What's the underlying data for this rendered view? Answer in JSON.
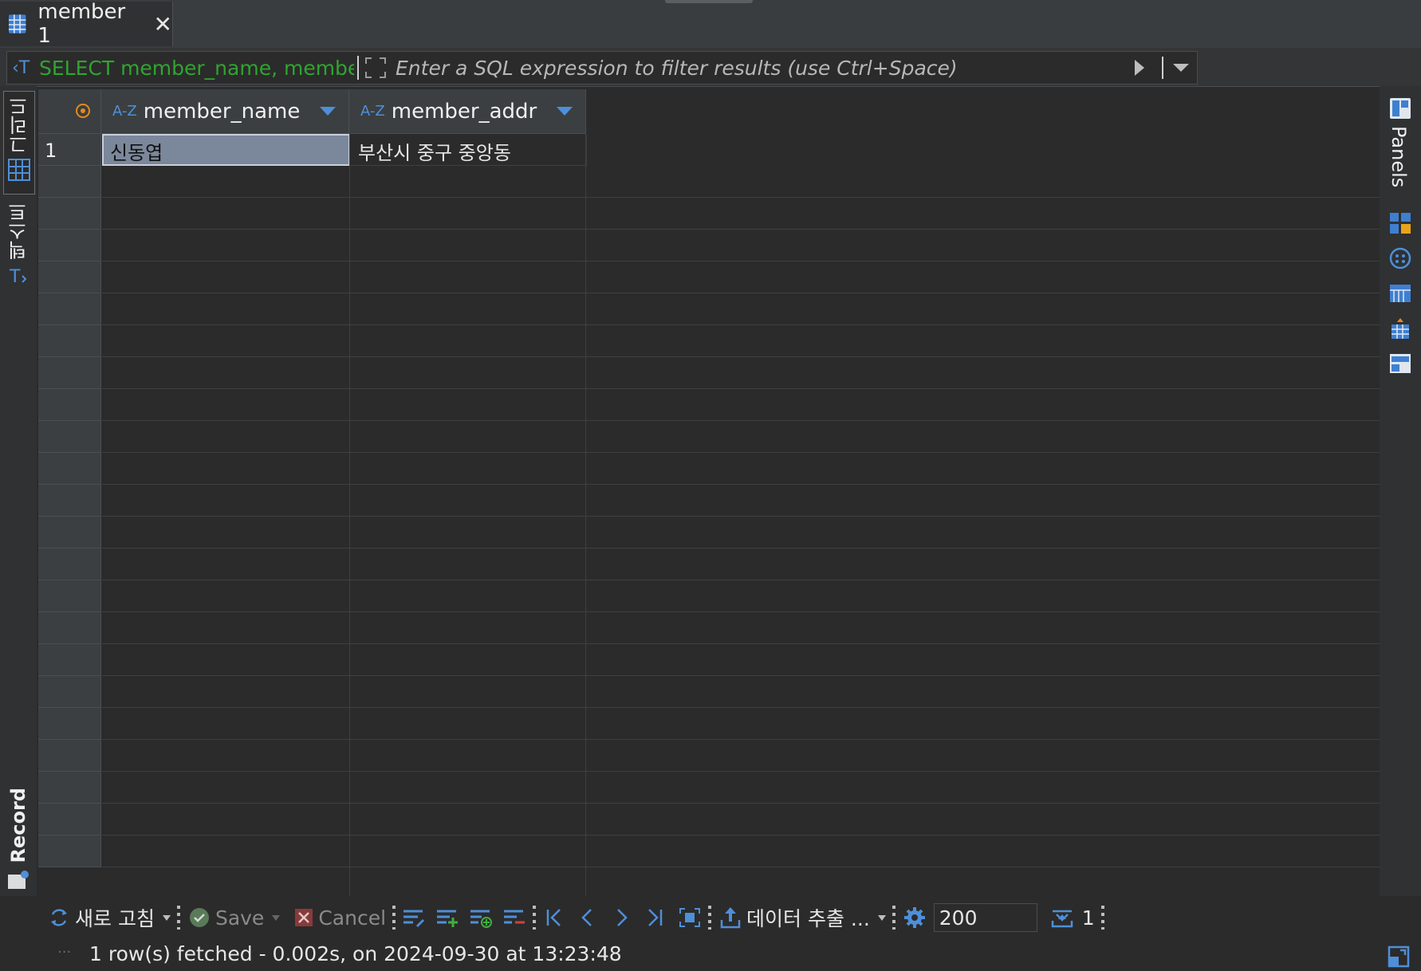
{
  "tab": {
    "title": "member 1",
    "close": "✕"
  },
  "filter": {
    "sql_prefix_icon": "sql-icon",
    "query": "SELECT member_name, membe",
    "placeholder": "Enter a SQL expression to filter results (use Ctrl+Space)"
  },
  "left_tabs": {
    "grid": "그리드",
    "text": "텍스트",
    "record": "Record"
  },
  "right_panel": {
    "label": "Panels"
  },
  "grid": {
    "columns": [
      {
        "type": "A-Z",
        "name": "member_name"
      },
      {
        "type": "A-Z",
        "name": "member_addr"
      }
    ],
    "rows": [
      {
        "num": "1",
        "cells": [
          "신동엽",
          "부산시 중구 중앙동"
        ]
      }
    ]
  },
  "toolbar": {
    "refresh": "새로 고침",
    "save": "Save",
    "cancel": "Cancel",
    "export": "데이터 추출 ...",
    "fetch_size": "200",
    "row_count": "1"
  },
  "status": {
    "message": "1 row(s) fetched - 0.002s, on 2024-09-30 at 13:23:48",
    "dots": "···"
  },
  "colors": {
    "accent": "#4e8fd8",
    "sql_green": "#2fa52f",
    "selected_cell": "#7b879a",
    "orange": "#e8891a"
  }
}
